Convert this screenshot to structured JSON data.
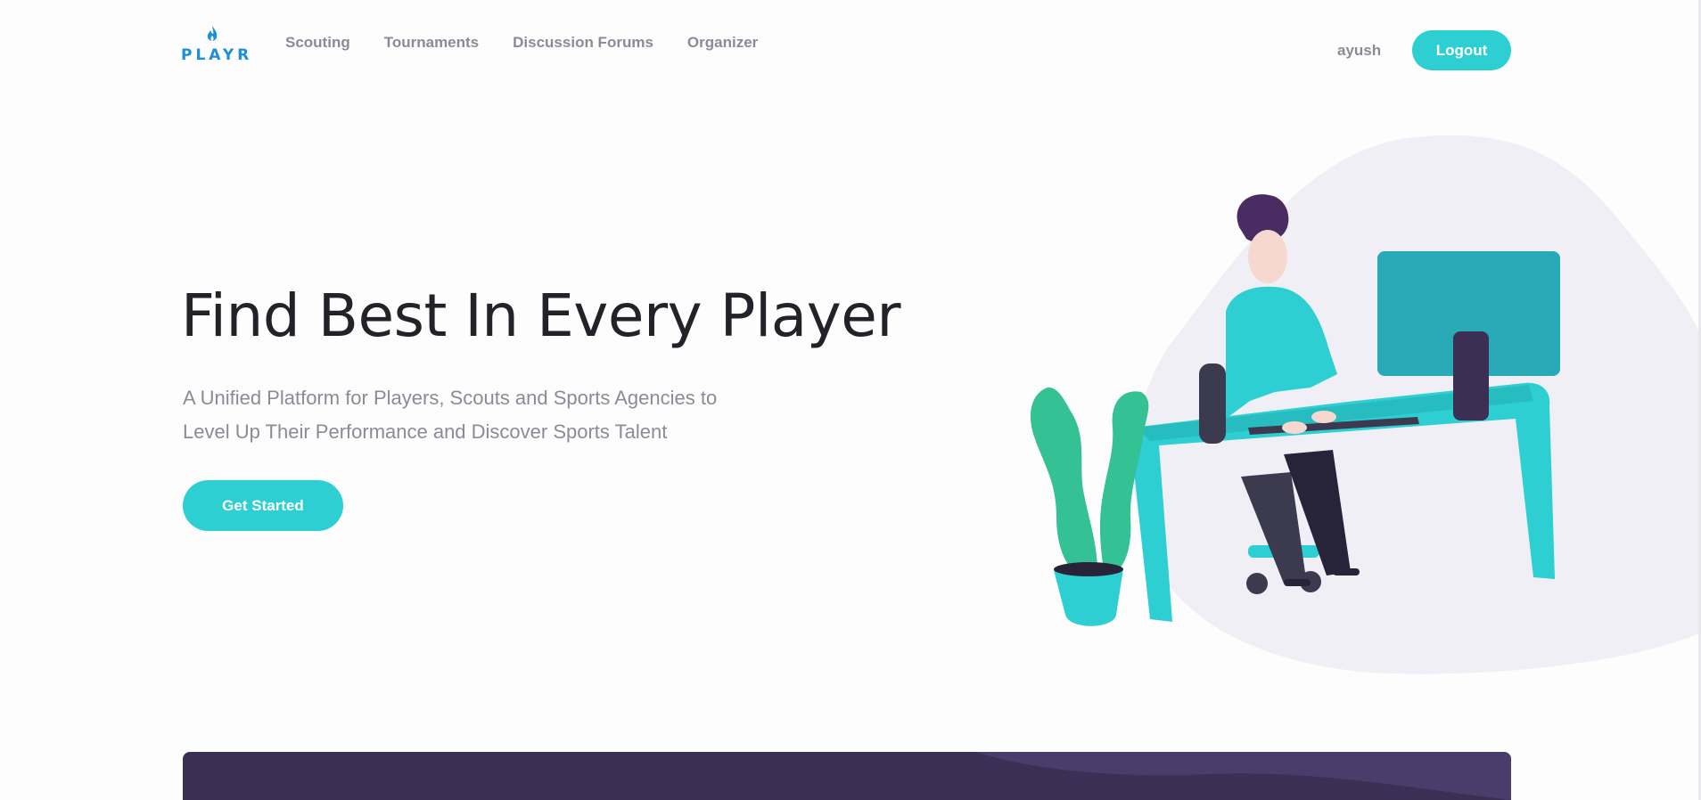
{
  "brand": {
    "name": "PLAYR",
    "color": "#1d8fd8",
    "icon": "flame-icon"
  },
  "nav": {
    "items": [
      {
        "label": "Scouting"
      },
      {
        "label": "Tournaments"
      },
      {
        "label": "Discussion Forums"
      },
      {
        "label": "Organizer"
      }
    ]
  },
  "user": {
    "name": "ayush",
    "logout_label": "Logout"
  },
  "hero": {
    "title": "Find Best In Every Player",
    "subtitle": "A Unified Platform for Players, Scouts and Sports Agencies to Level Up Their Performance and Discover Sports Talent",
    "cta_label": "Get Started"
  },
  "colors": {
    "accent": "#2ecfd2",
    "text_muted": "#8b8b98",
    "heading": "#222229",
    "band": "#3b2f55"
  }
}
